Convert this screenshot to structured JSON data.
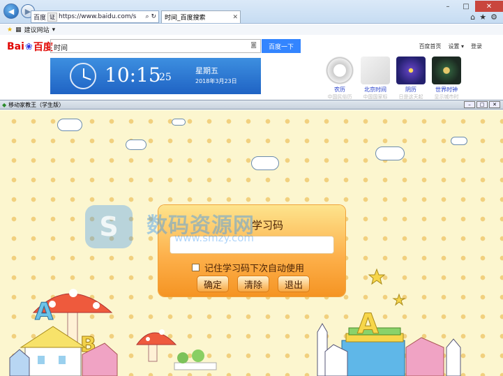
{
  "browser": {
    "address_site": "百度",
    "address_badge": "证",
    "address_url": "https://www.baidu.com/s",
    "tab_title": "时间_百度搜索",
    "favorites_label": "建议网站"
  },
  "baidu": {
    "search_value": "时间",
    "search_button": "百度一下",
    "links": [
      "百度首页",
      "设置",
      "登录"
    ],
    "clock": {
      "time": "10:15",
      "seconds": "25",
      "weekday": "星期五",
      "date": "2018年3月23日"
    },
    "thumbs": [
      {
        "label": "农历",
        "sub": "中国民俗历"
      },
      {
        "label": "北京时间",
        "sub": "中国国家标"
      },
      {
        "label": "阴历",
        "sub": "日是这天起"
      },
      {
        "label": "世界时钟",
        "sub": "显示城市时"
      }
    ]
  },
  "app": {
    "window_title": "移动家教王（学生版）",
    "panel_title": "学习码",
    "remember_label": "记住学习码下次自动使用",
    "buttons": {
      "ok": "确定",
      "clear": "清除",
      "exit": "退出"
    },
    "watermark": "数码资源网",
    "watermark_url": "www.smzy.com"
  },
  "colors": {
    "accent": "#3385ff",
    "panel": "#fdb14c",
    "background": "#fcf6cf"
  }
}
